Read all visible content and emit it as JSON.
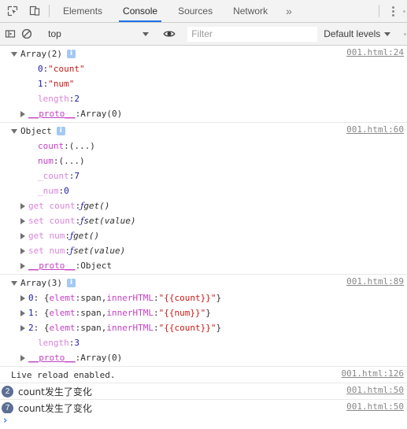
{
  "tabbar": {
    "icons": [
      {
        "name": "inspect-element-icon",
        "title": "Inspect"
      },
      {
        "name": "device-toolbar-icon",
        "title": "Toggle device toolbar"
      }
    ],
    "tabs": [
      {
        "label": "Elements",
        "active": false
      },
      {
        "label": "Console",
        "active": true
      },
      {
        "label": "Sources",
        "active": false
      },
      {
        "label": "Network",
        "active": false
      }
    ],
    "more_label": "»",
    "menu_icon": "more-options-icon"
  },
  "filterbar": {
    "sidebar_toggle_icon": "console-sidebar-icon",
    "clear_icon": "clear-console-icon",
    "context": "top",
    "eye_icon": "live-expression-icon",
    "filter_placeholder": "Filter",
    "filter_value": "",
    "levels_label": "Default levels",
    "settings_icon": "settings-icon"
  },
  "console": {
    "messages": [
      {
        "name": "array-2-group",
        "source": "001.html:24",
        "header": {
          "caret": "down",
          "label": "Array(2)",
          "info": "i"
        },
        "rows": [
          {
            "indent": 2,
            "caret": "none",
            "parts": [
              {
                "t": "num",
                "v": "0"
              },
              {
                "t": "punc",
                "v": ": "
              },
              {
                "t": "str",
                "v": "\"count\""
              }
            ]
          },
          {
            "indent": 2,
            "caret": "none",
            "parts": [
              {
                "t": "num",
                "v": "1"
              },
              {
                "t": "punc",
                "v": ": "
              },
              {
                "t": "str",
                "v": "\"num\""
              }
            ]
          },
          {
            "indent": 2,
            "caret": "none",
            "parts": [
              {
                "t": "keyl",
                "v": "length"
              },
              {
                "t": "punc",
                "v": ": "
              },
              {
                "t": "num",
                "v": "2"
              }
            ]
          },
          {
            "indent": 1,
            "caret": "right",
            "parts": [
              {
                "t": "proto",
                "v": "__proto__"
              },
              {
                "t": "punc",
                "v": ": "
              },
              {
                "t": "plain",
                "v": "Array(0)"
              }
            ]
          }
        ]
      },
      {
        "name": "object-group",
        "source": "001.html:60",
        "header": {
          "caret": "down",
          "label": "Object",
          "info": "i"
        },
        "rows": [
          {
            "indent": 2,
            "caret": "none",
            "parts": [
              {
                "t": "key",
                "v": "count"
              },
              {
                "t": "punc",
                "v": ": "
              },
              {
                "t": "plain",
                "v": "(...)"
              }
            ]
          },
          {
            "indent": 2,
            "caret": "none",
            "parts": [
              {
                "t": "key",
                "v": "num"
              },
              {
                "t": "punc",
                "v": ": "
              },
              {
                "t": "plain",
                "v": "(...)"
              }
            ]
          },
          {
            "indent": 2,
            "caret": "none",
            "parts": [
              {
                "t": "keyl",
                "v": "_count"
              },
              {
                "t": "punc",
                "v": ": "
              },
              {
                "t": "num",
                "v": "7"
              }
            ]
          },
          {
            "indent": 2,
            "caret": "none",
            "parts": [
              {
                "t": "keyl",
                "v": "_num"
              },
              {
                "t": "punc",
                "v": ": "
              },
              {
                "t": "num",
                "v": "0"
              }
            ]
          },
          {
            "indent": 1,
            "caret": "right",
            "parts": [
              {
                "t": "keyl",
                "v": "get count"
              },
              {
                "t": "punc",
                "v": ": "
              },
              {
                "t": "fn",
                "v": "ƒ "
              },
              {
                "t": "fnsig",
                "v": "get()"
              }
            ]
          },
          {
            "indent": 1,
            "caret": "right",
            "parts": [
              {
                "t": "keyl",
                "v": "set count"
              },
              {
                "t": "punc",
                "v": ": "
              },
              {
                "t": "fn",
                "v": "ƒ "
              },
              {
                "t": "fnsig",
                "v": "set(value)"
              }
            ]
          },
          {
            "indent": 1,
            "caret": "right",
            "parts": [
              {
                "t": "keyl",
                "v": "get num"
              },
              {
                "t": "punc",
                "v": ": "
              },
              {
                "t": "fn",
                "v": "ƒ "
              },
              {
                "t": "fnsig",
                "v": "get()"
              }
            ]
          },
          {
            "indent": 1,
            "caret": "right",
            "parts": [
              {
                "t": "keyl",
                "v": "set num"
              },
              {
                "t": "punc",
                "v": ": "
              },
              {
                "t": "fn",
                "v": "ƒ "
              },
              {
                "t": "fnsig",
                "v": "set(value)"
              }
            ]
          },
          {
            "indent": 1,
            "caret": "right",
            "parts": [
              {
                "t": "proto",
                "v": "__proto__"
              },
              {
                "t": "punc",
                "v": ": "
              },
              {
                "t": "plain",
                "v": "Object"
              }
            ]
          }
        ]
      },
      {
        "name": "array-3-group",
        "source": "001.html:89",
        "header": {
          "caret": "down",
          "label": "Array(3)",
          "info": "i"
        },
        "rows": [
          {
            "indent": 1,
            "caret": "right",
            "parts": [
              {
                "t": "num",
                "v": "0"
              },
              {
                "t": "punc",
                "v": ": {"
              },
              {
                "t": "key",
                "v": "elemt"
              },
              {
                "t": "punc",
                "v": ": "
              },
              {
                "t": "plain",
                "v": "span"
              },
              {
                "t": "punc",
                "v": ", "
              },
              {
                "t": "key",
                "v": "innerHTML"
              },
              {
                "t": "punc",
                "v": ": "
              },
              {
                "t": "str",
                "v": "\"{{count}}\""
              },
              {
                "t": "punc",
                "v": "}"
              }
            ]
          },
          {
            "indent": 1,
            "caret": "right",
            "parts": [
              {
                "t": "num",
                "v": "1"
              },
              {
                "t": "punc",
                "v": ": {"
              },
              {
                "t": "key",
                "v": "elemt"
              },
              {
                "t": "punc",
                "v": ": "
              },
              {
                "t": "plain",
                "v": "span"
              },
              {
                "t": "punc",
                "v": ", "
              },
              {
                "t": "key",
                "v": "innerHTML"
              },
              {
                "t": "punc",
                "v": ": "
              },
              {
                "t": "str",
                "v": "\"{{num}}\""
              },
              {
                "t": "punc",
                "v": "}"
              }
            ]
          },
          {
            "indent": 1,
            "caret": "right",
            "parts": [
              {
                "t": "num",
                "v": "2"
              },
              {
                "t": "punc",
                "v": ": {"
              },
              {
                "t": "key",
                "v": "elemt"
              },
              {
                "t": "punc",
                "v": ": "
              },
              {
                "t": "plain",
                "v": "span"
              },
              {
                "t": "punc",
                "v": ", "
              },
              {
                "t": "key",
                "v": "innerHTML"
              },
              {
                "t": "punc",
                "v": ": "
              },
              {
                "t": "str",
                "v": "\"{{count}}\""
              },
              {
                "t": "punc",
                "v": "}"
              }
            ]
          },
          {
            "indent": 2,
            "caret": "none",
            "parts": [
              {
                "t": "keyl",
                "v": "length"
              },
              {
                "t": "punc",
                "v": ": "
              },
              {
                "t": "num",
                "v": "3"
              }
            ]
          },
          {
            "indent": 1,
            "caret": "right",
            "parts": [
              {
                "t": "proto",
                "v": "__proto__"
              },
              {
                "t": "punc",
                "v": ": "
              },
              {
                "t": "plain",
                "v": "Array(0)"
              }
            ]
          }
        ]
      },
      {
        "name": "live-reload-message",
        "source": "001.html:126",
        "plain": {
          "text": "Live reload enabled.",
          "mono": true
        }
      },
      {
        "name": "count-changed-message-1",
        "source": "001.html:50",
        "plain": {
          "text": "count发生了变化",
          "badge": "2"
        }
      },
      {
        "name": "count-changed-message-2",
        "source": "001.html:50",
        "plain": {
          "text": "count发生了变化",
          "badge": "7"
        }
      }
    ],
    "prompt_chevron": "›"
  },
  "colors": {
    "accent": "#1a73e8",
    "string": "#c41a16",
    "number": "#1a1aa6",
    "key": "#c341c3",
    "badge": "#5c6f94",
    "info_badge": "#a3c9f5",
    "toolbar_bg": "#f3f3f3"
  }
}
